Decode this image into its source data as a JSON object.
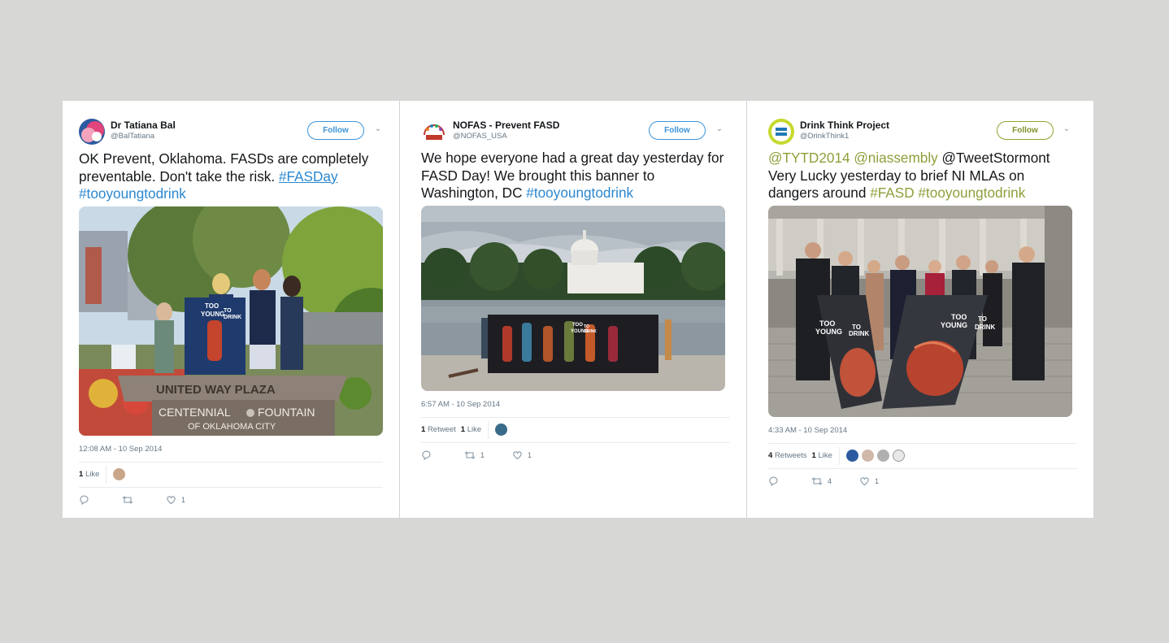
{
  "tweets": [
    {
      "name": "Dr Tatiana Bal",
      "handle": "@BalTatiana",
      "follow_label": "Follow",
      "text_plain": "OK Prevent, Oklahoma. FASDs are completely preventable. Don't take the risk.",
      "hashtags": [
        "#FASDay",
        "#tooyoungtodrink"
      ],
      "photo_signs": [
        "UNITED WAY PLAZA",
        "CENTENNIAL",
        "FOUNTAIN",
        "OF OKLAHOMA CITY"
      ],
      "banner_text": [
        "TOO",
        "YOUNG",
        "TO",
        "DRINK"
      ],
      "timestamp": "12:08 AM - 10 Sep 2014",
      "likes_count": "1",
      "likes_label": "Like",
      "action_likes": "1"
    },
    {
      "name": "NOFAS - Prevent FASD",
      "handle": "@NOFAS_USA",
      "follow_label": "Follow",
      "text_plain": "We hope everyone had a great day yesterday for FASD Day! We brought this banner to Washington, DC",
      "hashtags": [
        "#tooyoungtodrink"
      ],
      "banner_text": [
        "TOO",
        "YOUNG",
        "TO",
        "DRINK"
      ],
      "timestamp": "6:57 AM - 10 Sep 2014",
      "retweets_count": "1",
      "retweets_label": "Retweet",
      "likes_count": "1",
      "likes_label": "Like",
      "action_retweets": "1",
      "action_likes": "1"
    },
    {
      "name": "Drink Think Project",
      "handle": "@DrinkThink1",
      "follow_label": "Follow",
      "mentions": [
        "@TYTD2014",
        "@niassembly"
      ],
      "mention_plain": "@TweetStormont",
      "text_plain": "Very Lucky yesterday to brief NI MLAs on dangers around",
      "hashtags": [
        "#FASD",
        "#tooyoungtodrink"
      ],
      "banner_text": [
        "TOO",
        "YOUNG",
        "TO",
        "DRINK"
      ],
      "timestamp": "4:33 AM - 10 Sep 2014",
      "retweets_count": "4",
      "retweets_label": "Retweets",
      "likes_count": "1",
      "likes_label": "Like",
      "action_retweets": "4",
      "action_likes": "1"
    }
  ],
  "colors": {
    "link_blue": "#2a87d0",
    "link_green": "#8da03a",
    "page_bg": "#d7d7d5"
  },
  "icons": [
    "reply-icon",
    "retweet-icon",
    "like-icon",
    "chevron-down-icon"
  ]
}
